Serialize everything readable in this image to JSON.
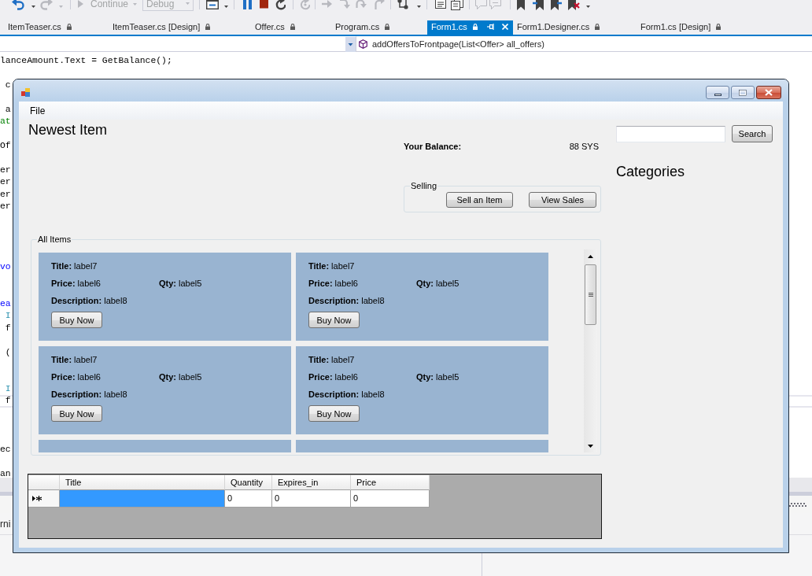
{
  "toolbar": {
    "items": [
      {
        "kind": "icon",
        "disabled": false
      },
      {
        "kind": "icon",
        "disabled": true
      },
      {
        "kind": "button",
        "label": "Continue",
        "disabled": true
      },
      {
        "kind": "combo",
        "value": "Debug",
        "disabled": true
      },
      {
        "kind": "icon",
        "disabled": false
      },
      {
        "kind": "icon",
        "disabled": false
      },
      {
        "kind": "icon",
        "disabled": false
      },
      {
        "kind": "icon",
        "disabled": false
      },
      {
        "kind": "icon",
        "disabled": true
      },
      {
        "kind": "icon",
        "disabled": true
      },
      {
        "kind": "icon",
        "disabled": true
      },
      {
        "kind": "icon",
        "disabled": true
      },
      {
        "kind": "icon",
        "disabled": true
      },
      {
        "kind": "icon",
        "disabled": false
      },
      {
        "kind": "icon",
        "disabled": false
      },
      {
        "kind": "icon",
        "disabled": false
      },
      {
        "kind": "icon",
        "disabled": true
      },
      {
        "kind": "icon",
        "disabled": true
      },
      {
        "kind": "icon",
        "disabled": false
      },
      {
        "kind": "icon",
        "disabled": false
      },
      {
        "kind": "icon",
        "disabled": false
      },
      {
        "kind": "icon",
        "disabled": false
      }
    ]
  },
  "tabs": [
    {
      "label": "ItemTeaser.cs",
      "selected": false
    },
    {
      "label": "ItemTeaser.cs [Design]",
      "selected": false
    },
    {
      "label": "Offer.cs",
      "selected": false
    },
    {
      "label": "Program.cs",
      "selected": false
    },
    {
      "label": "Form1.cs",
      "selected": true
    },
    {
      "label": "Form1.Designer.cs",
      "selected": false
    },
    {
      "label": "Form1.cs [Design]",
      "selected": false
    }
  ],
  "navigation_bar": {
    "member": "addOffersToFrontpage(List<Offer> all_offers)"
  },
  "code_editor": {
    "lines": [
      {
        "kind": "code",
        "current": false,
        "tokens": [
          {
            "kind": "plain",
            "text": "lanceAmount.Text = GetBalance();"
          }
        ]
      },
      {
        "kind": "blank",
        "current": false
      },
      {
        "kind": "code",
        "current": false,
        "tokens": [
          {
            "kind": "plain",
            "text": " c"
          }
        ]
      },
      {
        "kind": "blank",
        "current": false
      },
      {
        "kind": "code",
        "current": false,
        "tokens": [
          {
            "kind": "plain",
            "text": " a"
          }
        ]
      },
      {
        "kind": "code",
        "current": false,
        "tokens": [
          {
            "kind": "comment",
            "text": "at"
          }
        ]
      },
      {
        "kind": "blank",
        "current": false
      },
      {
        "kind": "code",
        "current": false,
        "tokens": [
          {
            "kind": "plain",
            "text": "Of"
          }
        ]
      },
      {
        "kind": "blank",
        "current": false
      },
      {
        "kind": "code",
        "current": false,
        "tokens": [
          {
            "kind": "plain",
            "text": "er"
          }
        ]
      },
      {
        "kind": "code",
        "current": false,
        "tokens": [
          {
            "kind": "plain",
            "text": "er"
          }
        ]
      },
      {
        "kind": "code",
        "current": false,
        "tokens": [
          {
            "kind": "plain",
            "text": "er"
          }
        ]
      },
      {
        "kind": "code",
        "current": false,
        "tokens": [
          {
            "kind": "plain",
            "text": "er"
          }
        ]
      },
      {
        "kind": "blank",
        "current": false
      },
      {
        "kind": "blank",
        "current": false
      },
      {
        "kind": "blank",
        "current": false
      },
      {
        "kind": "blank",
        "current": false
      },
      {
        "kind": "code",
        "current": false,
        "tokens": [
          {
            "kind": "keyword",
            "text": "vo"
          }
        ]
      },
      {
        "kind": "blank",
        "current": false
      },
      {
        "kind": "blank",
        "current": false
      },
      {
        "kind": "code",
        "current": false,
        "tokens": [
          {
            "kind": "keyword",
            "text": "ea"
          }
        ]
      },
      {
        "kind": "code",
        "current": false,
        "tokens": [
          {
            "kind": "type",
            "text": " I"
          }
        ]
      },
      {
        "kind": "code",
        "current": false,
        "tokens": [
          {
            "kind": "plain",
            "text": " f"
          }
        ]
      },
      {
        "kind": "blank",
        "current": false
      },
      {
        "kind": "code",
        "current": false,
        "tokens": [
          {
            "kind": "plain",
            "text": " ("
          }
        ]
      },
      {
        "kind": "blank",
        "current": false
      },
      {
        "kind": "blank",
        "current": false
      },
      {
        "kind": "code",
        "current": false,
        "tokens": [
          {
            "kind": "type",
            "text": " I"
          }
        ]
      },
      {
        "kind": "code",
        "current": true,
        "tokens": [
          {
            "kind": "plain",
            "text": " f"
          }
        ]
      },
      {
        "kind": "blank",
        "current": false
      },
      {
        "kind": "blank",
        "current": false
      },
      {
        "kind": "blank",
        "current": false
      },
      {
        "kind": "code",
        "current": false,
        "tokens": [
          {
            "kind": "plain",
            "text": "ec"
          }
        ]
      },
      {
        "kind": "blank",
        "current": false
      },
      {
        "kind": "code",
        "current": false,
        "tokens": [
          {
            "kind": "plain",
            "text": "an"
          }
        ]
      }
    ]
  },
  "tool_window": {
    "toolbar_text": "rni"
  },
  "form": {
    "menu": [
      {
        "label": "File"
      }
    ],
    "heading": "Newest Item",
    "balance": {
      "label": "Your Balance:",
      "value": "88 SYS"
    },
    "selling": {
      "legend": "Selling",
      "buttons": [
        {
          "label": "Sell an Item"
        },
        {
          "label": "View Sales"
        }
      ]
    },
    "search": {
      "button": "Search"
    },
    "categories_heading": "Categories",
    "all_items": {
      "legend": "All Items",
      "items": [
        {
          "kind": "card",
          "title_label": "Title:",
          "title": "label7",
          "price_label": "Price:",
          "price": "label6",
          "qty_label": "Qty:",
          "qty": "label5",
          "description_label": "Description:",
          "description": "label8",
          "button": "Buy Now"
        },
        {
          "kind": "card",
          "title_label": "Title:",
          "title": "label7",
          "price_label": "Price:",
          "price": "label6",
          "qty_label": "Qty:",
          "qty": "label5",
          "description_label": "Description:",
          "description": "label8",
          "button": "Buy Now"
        },
        {
          "kind": "card",
          "title_label": "Title:",
          "title": "label7",
          "price_label": "Price:",
          "price": "label6",
          "qty_label": "Qty:",
          "qty": "label5",
          "description_label": "Description:",
          "description": "label8",
          "button": "Buy Now"
        },
        {
          "kind": "card",
          "title_label": "Title:",
          "title": "label7",
          "price_label": "Price:",
          "price": "label6",
          "qty_label": "Qty:",
          "qty": "label5",
          "description_label": "Description:",
          "description": "label8",
          "button": "Buy Now"
        },
        {
          "kind": "cut"
        },
        {
          "kind": "cut"
        }
      ]
    },
    "grid": {
      "columns": [
        {
          "label": "Title"
        },
        {
          "label": "Quantity"
        },
        {
          "label": "Expires_in"
        },
        {
          "label": "Price"
        }
      ],
      "rows": [
        {
          "current": true,
          "new_row": true,
          "cells": [
            {
              "selected": true
            },
            {
              "value": "0",
              "selected": false
            },
            {
              "value": "0",
              "selected": false
            },
            {
              "value": "0",
              "selected": false
            }
          ]
        }
      ]
    }
  }
}
